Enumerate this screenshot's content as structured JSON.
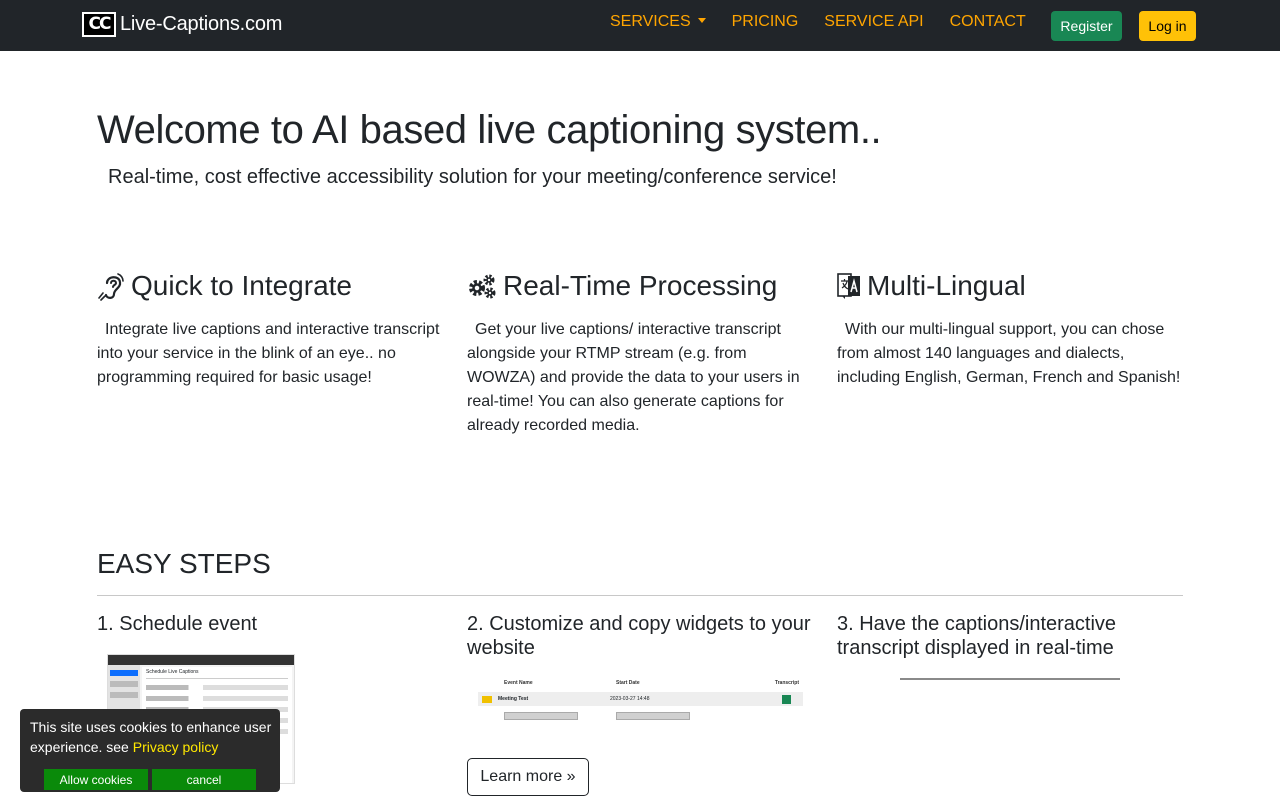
{
  "navbar": {
    "logo_icon": "cc-logo-icon",
    "logo_text": "CC",
    "brand": "Live-Captions.com",
    "links": [
      {
        "label": "SERVICES",
        "has_dropdown": true
      },
      {
        "label": "PRICING"
      },
      {
        "label": "SERVICE API"
      },
      {
        "label": "CONTACT"
      }
    ],
    "register_label": "Register",
    "login_label": "Log in",
    "link_color": "#ffa500",
    "register_color": "#198754",
    "login_color": "#ffc107"
  },
  "hero": {
    "title": "Welcome to AI based live captioning system..",
    "subtitle": "Real-time, cost effective accessibility solution for your meeting/conference service!"
  },
  "features": [
    {
      "icon": "hearing-icon",
      "title": "Quick to Integrate",
      "text": "Integrate live captions and interactive transcript into your service in the blink of an eye.. no programming required for basic usage!"
    },
    {
      "icon": "gears-icon",
      "title": "Real-Time Processing",
      "text": "Get your live captions/ interactive transcript alongside your RTMP stream (e.g. from WOWZA) and provide the data to your users in real-time! You can also generate captions for already recorded media."
    },
    {
      "icon": "translate-icon",
      "title": "Multi-Lingual",
      "text": "With our multi-lingual support, you can chose from almost 140 languages and dialects, including English, German, French and Spanish!"
    }
  ],
  "steps": {
    "title": "EASY STEPS",
    "items": [
      {
        "title": "1. Schedule event",
        "screenshot_title": "Schedule Live Captions"
      },
      {
        "title": "2. Customize and copy widgets to your website",
        "columns": [
          "Event Name",
          "Start Date",
          "Transcript"
        ],
        "row_name": "Meeting Test",
        "row_date": "2023-03-27 14:48"
      },
      {
        "title": "3. Have the captions/interactive transcript displayed in real-time"
      }
    ],
    "learn_more_label": "Learn more »"
  },
  "cookie": {
    "text": "This site uses cookies to enhance user experience. see ",
    "link": "Privacy policy",
    "allow_label": "Allow cookies",
    "cancel_label": "cancel",
    "link_color": "#ffe800",
    "button_color": "#0a8a0a"
  }
}
